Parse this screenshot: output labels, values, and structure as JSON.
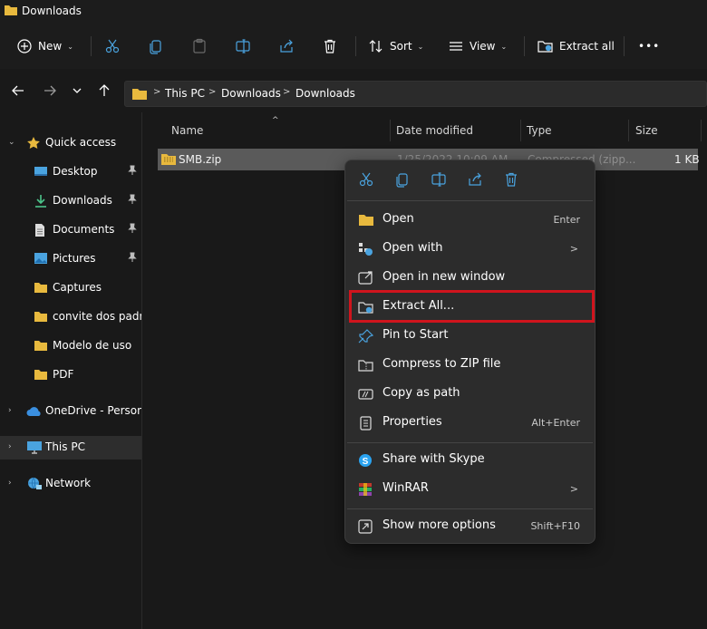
{
  "window": {
    "title": "Downloads"
  },
  "toolbar": {
    "new_label": "New",
    "sort_label": "Sort",
    "view_label": "View",
    "extract_all_label": "Extract all",
    "more_label": "•••"
  },
  "address": {
    "crumbs": [
      "This PC",
      "Downloads",
      "Downloads"
    ],
    "separator": ">"
  },
  "sidebar": {
    "items": [
      {
        "label": "Quick access",
        "icon": "star-icon"
      },
      {
        "label": "Desktop",
        "icon": "desktop-icon",
        "pinned": true
      },
      {
        "label": "Downloads",
        "icon": "download-icon",
        "pinned": true
      },
      {
        "label": "Documents",
        "icon": "document-icon",
        "pinned": true
      },
      {
        "label": "Pictures",
        "icon": "pictures-icon",
        "pinned": true
      },
      {
        "label": "Captures",
        "icon": "folder-icon"
      },
      {
        "label": "convite dos padrinhos",
        "icon": "folder-icon"
      },
      {
        "label": "Modelo de uso",
        "icon": "folder-icon"
      },
      {
        "label": "PDF",
        "icon": "folder-icon"
      },
      {
        "label": "OneDrive - Personal",
        "icon": "cloud-icon"
      },
      {
        "label": "This PC",
        "icon": "monitor-icon",
        "selected": true
      },
      {
        "label": "Network",
        "icon": "network-icon"
      }
    ]
  },
  "filelist": {
    "columns": [
      "Name",
      "Date modified",
      "Type",
      "Size"
    ],
    "rows": [
      {
        "name": "SMB.zip",
        "date": "1/25/2022 10:09 AM",
        "type": "Compressed (zipp...",
        "size": "1 KB"
      }
    ]
  },
  "context_menu": {
    "items": [
      {
        "label": "Open",
        "shortcut": "Enter",
        "icon": "folder-open-icon"
      },
      {
        "label": "Open with",
        "submenu": true,
        "icon": "open-with-icon"
      },
      {
        "label": "Open in new window",
        "icon": "new-window-icon"
      },
      {
        "label": "Extract All...",
        "icon": "extract-icon",
        "highlighted": true
      },
      {
        "label": "Pin to Start",
        "icon": "pin-icon"
      },
      {
        "label": "Compress to ZIP file",
        "icon": "zip-icon"
      },
      {
        "label": "Copy as path",
        "icon": "copy-path-icon"
      },
      {
        "label": "Properties",
        "shortcut": "Alt+Enter",
        "icon": "properties-icon"
      },
      {
        "label": "Share with Skype",
        "icon": "skype-icon"
      },
      {
        "label": "WinRAR",
        "submenu": true,
        "icon": "winrar-icon"
      },
      {
        "label": "Show more options",
        "shortcut": "Shift+F10",
        "icon": "more-options-icon"
      }
    ],
    "submenu_arrow": ">"
  },
  "colors": {
    "background": "#191919",
    "menu_bg": "#2c2c2c",
    "selected_row": "#5a5a5a",
    "highlight_border": "#d0141d",
    "folder_yellow": "#e8b93e",
    "accent_blue": "#4aa3df"
  }
}
